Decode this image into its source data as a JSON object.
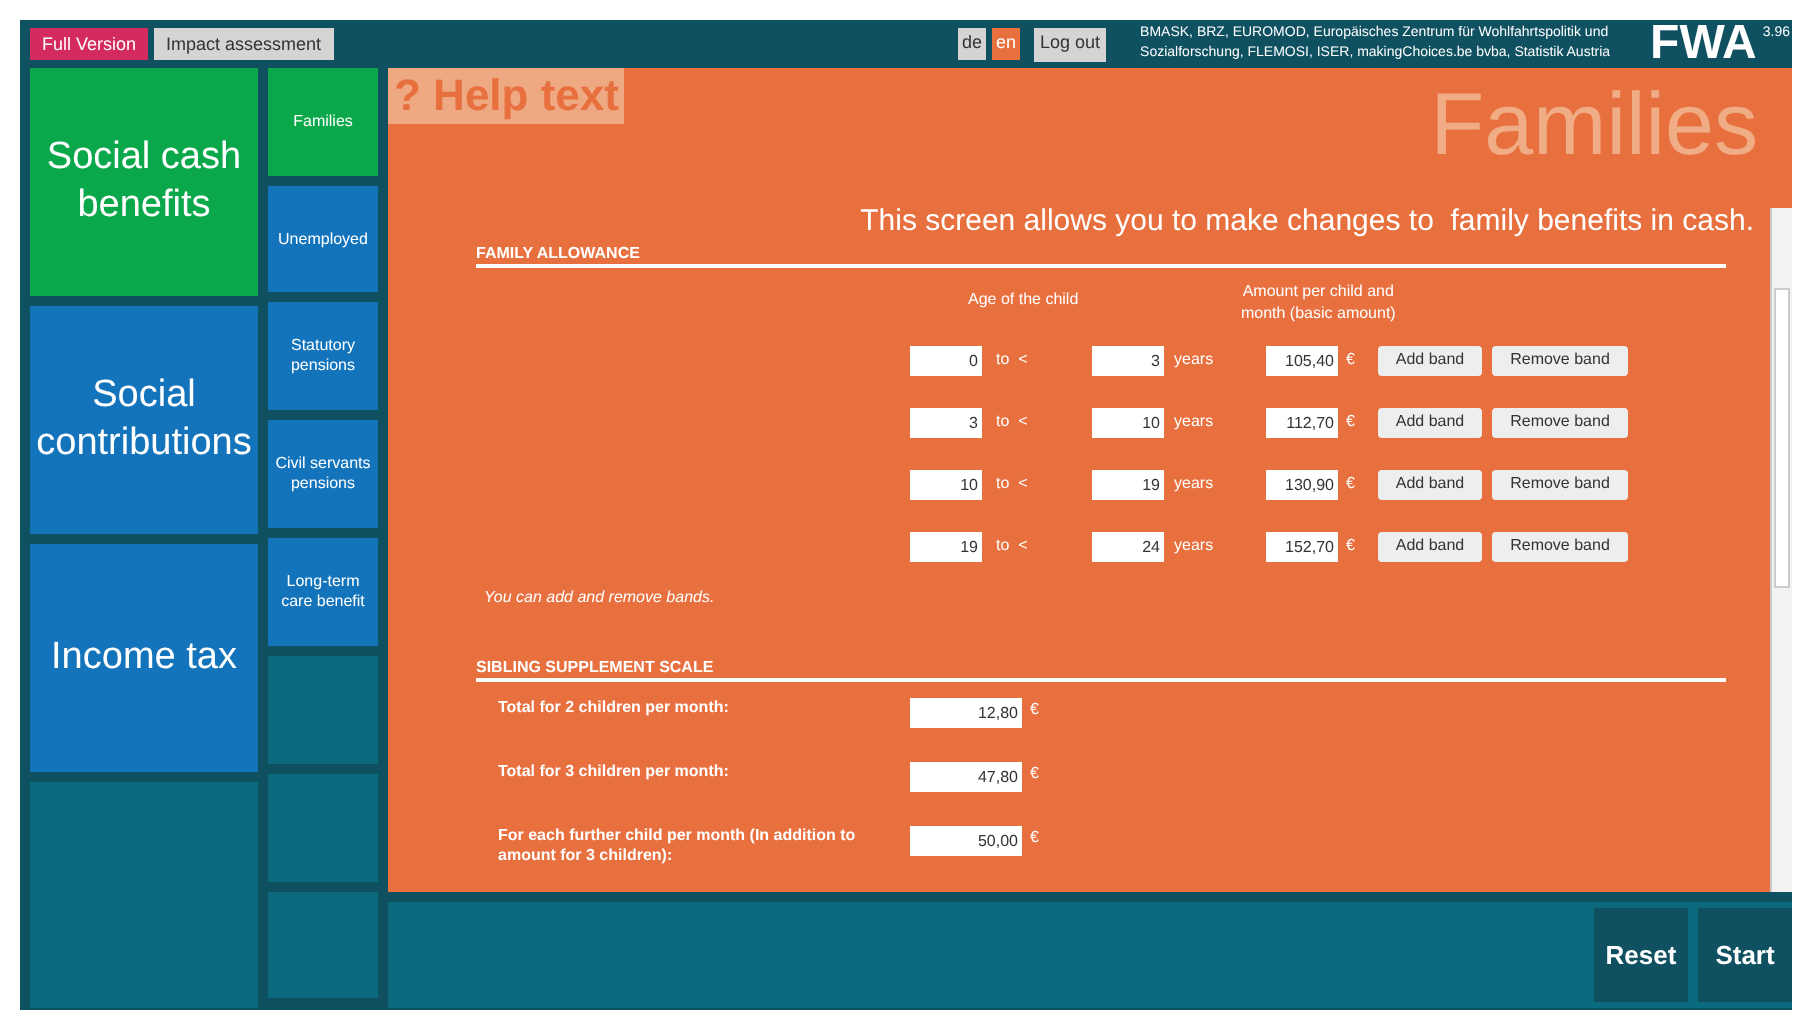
{
  "top_bar": {
    "version_tabs": [
      {
        "label": "Full Version",
        "selected": true
      },
      {
        "label": "Impact assessment",
        "selected": false
      }
    ],
    "languages": [
      {
        "label": "de",
        "selected": false
      },
      {
        "label": "en",
        "selected": true
      }
    ],
    "logout": "Log out",
    "credits": "BMASK, BRZ, EUROMOD, Europäisches Zentrum für Wohlfahrtspolitik und Sozialforschung, FLEMOSI, ISER, makingChoices.be bvba, Statistik Austria",
    "logo": "FWA",
    "version": "3.96"
  },
  "categories": [
    {
      "label": "Social cash benefits",
      "selected": true
    },
    {
      "label": "Social contributions",
      "selected": false
    },
    {
      "label": "Income tax",
      "selected": false
    }
  ],
  "subcategories": [
    {
      "label": "Families",
      "selected": true
    },
    {
      "label": "Unemployed",
      "selected": false
    },
    {
      "label": "Statutory pensions",
      "selected": false
    },
    {
      "label": "Civil servants pensions",
      "selected": false
    },
    {
      "label": "Long-term care benefit",
      "selected": false
    }
  ],
  "panel": {
    "help": "? Help text",
    "title": "Families",
    "intro": "This screen allows you to make changes to  family benefits in cash.",
    "family_allowance": {
      "heading": "FAMILY ALLOWANCE",
      "age_header": "Age of the child",
      "amount_header": "Amount per child and month (basic amount)",
      "bands": [
        {
          "from": "0",
          "to_label": "to  <",
          "to": "3",
          "unit": "years",
          "amount": "105,40",
          "currency": "€",
          "add": "Add band",
          "remove": "Remove band"
        },
        {
          "from": "3",
          "to_label": "to  <",
          "to": "10",
          "unit": "years",
          "amount": "112,70",
          "currency": "€",
          "add": "Add band",
          "remove": "Remove band"
        },
        {
          "from": "10",
          "to_label": "to  <",
          "to": "19",
          "unit": "years",
          "amount": "130,90",
          "currency": "€",
          "add": "Add band",
          "remove": "Remove band"
        },
        {
          "from": "19",
          "to_label": "to  <",
          "to": "24",
          "unit": "years",
          "amount": "152,70",
          "currency": "€",
          "add": "Add band",
          "remove": "Remove band"
        }
      ],
      "note": "You can add and remove bands."
    },
    "sibling_supplement": {
      "heading": "SIBLING SUPPLEMENT SCALE",
      "rows": [
        {
          "label": "Total for 2 children per month:",
          "value": "12,80",
          "currency": "€"
        },
        {
          "label": "Total for 3 children per month:",
          "value": "47,80",
          "currency": "€"
        },
        {
          "label": "For each further child per month (In addition to amount for 3 children):",
          "value": "50,00",
          "currency": "€"
        }
      ]
    }
  },
  "actions": [
    "Reset",
    "Start"
  ]
}
